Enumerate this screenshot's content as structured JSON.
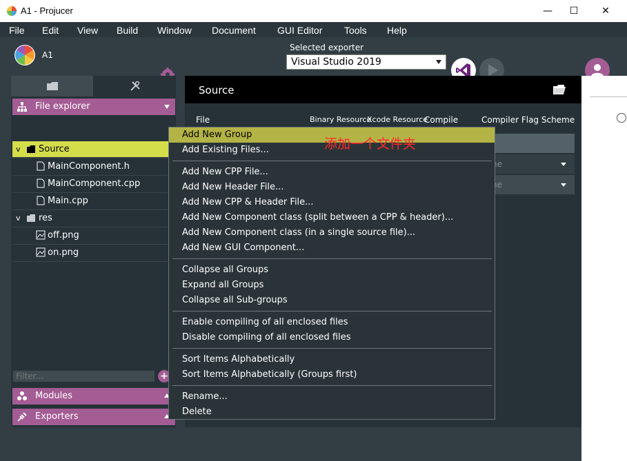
{
  "window": {
    "title": "A1 - Projucer",
    "minimize": "—",
    "maximize": "☐",
    "close": "✕"
  },
  "menubar": [
    "File",
    "Edit",
    "View",
    "Build",
    "Window",
    "Document",
    "GUI Editor",
    "Tools",
    "Help"
  ],
  "header": {
    "project_name": "A1",
    "exporter_label": "Selected exporter",
    "exporter_value": "Visual Studio 2019"
  },
  "sidebar": {
    "file_explorer_label": "File explorer",
    "tree": [
      {
        "label": "Source",
        "expanded": true,
        "selected": true
      },
      {
        "label": "MainComponent.h"
      },
      {
        "label": "MainComponent.cpp"
      },
      {
        "label": "Main.cpp"
      },
      {
        "label": "res",
        "expanded": true
      },
      {
        "label": "off.png"
      },
      {
        "label": "on.png"
      }
    ],
    "filter_placeholder": "Filter...",
    "modules_label": "Modules",
    "exporters_label": "Exporters"
  },
  "main": {
    "title": "Source",
    "columns": {
      "file": "File",
      "binary": "Binary Resource",
      "xcode": "Xcode Resource",
      "compile": "Compile",
      "flag": "Compiler Flag Scheme"
    },
    "row_scheme_partial": "ne"
  },
  "context_menu": {
    "items": [
      {
        "label": "Add New Group",
        "highlighted": true
      },
      {
        "label": "Add Existing Files..."
      },
      {
        "sep": true
      },
      {
        "label": "Add New CPP File..."
      },
      {
        "label": "Add New Header File..."
      },
      {
        "label": "Add New CPP & Header File..."
      },
      {
        "label": "Add New Component class (split between a CPP & header)..."
      },
      {
        "label": "Add New Component class (in a single source file)..."
      },
      {
        "label": "Add New GUI Component..."
      },
      {
        "sep": true
      },
      {
        "label": "Collapse all Groups"
      },
      {
        "label": "Expand all Groups"
      },
      {
        "label": "Collapse all Sub-groups"
      },
      {
        "sep": true
      },
      {
        "label": "Enable compiling of all enclosed files"
      },
      {
        "label": "Disable compiling of all enclosed files"
      },
      {
        "sep": true
      },
      {
        "label": "Sort Items Alphabetically"
      },
      {
        "label": "Sort Items Alphabetically (Groups first)"
      },
      {
        "sep": true
      },
      {
        "label": "Rename..."
      },
      {
        "label": "Delete"
      }
    ],
    "annotation": "添加一个文件夹"
  },
  "colors": {
    "accent": "#a45c94",
    "selection": "#d4de4b",
    "menu_highlight": "#b3b346",
    "background": "#323e44",
    "panel": "#263238",
    "annotation": "#ff2a2a"
  }
}
